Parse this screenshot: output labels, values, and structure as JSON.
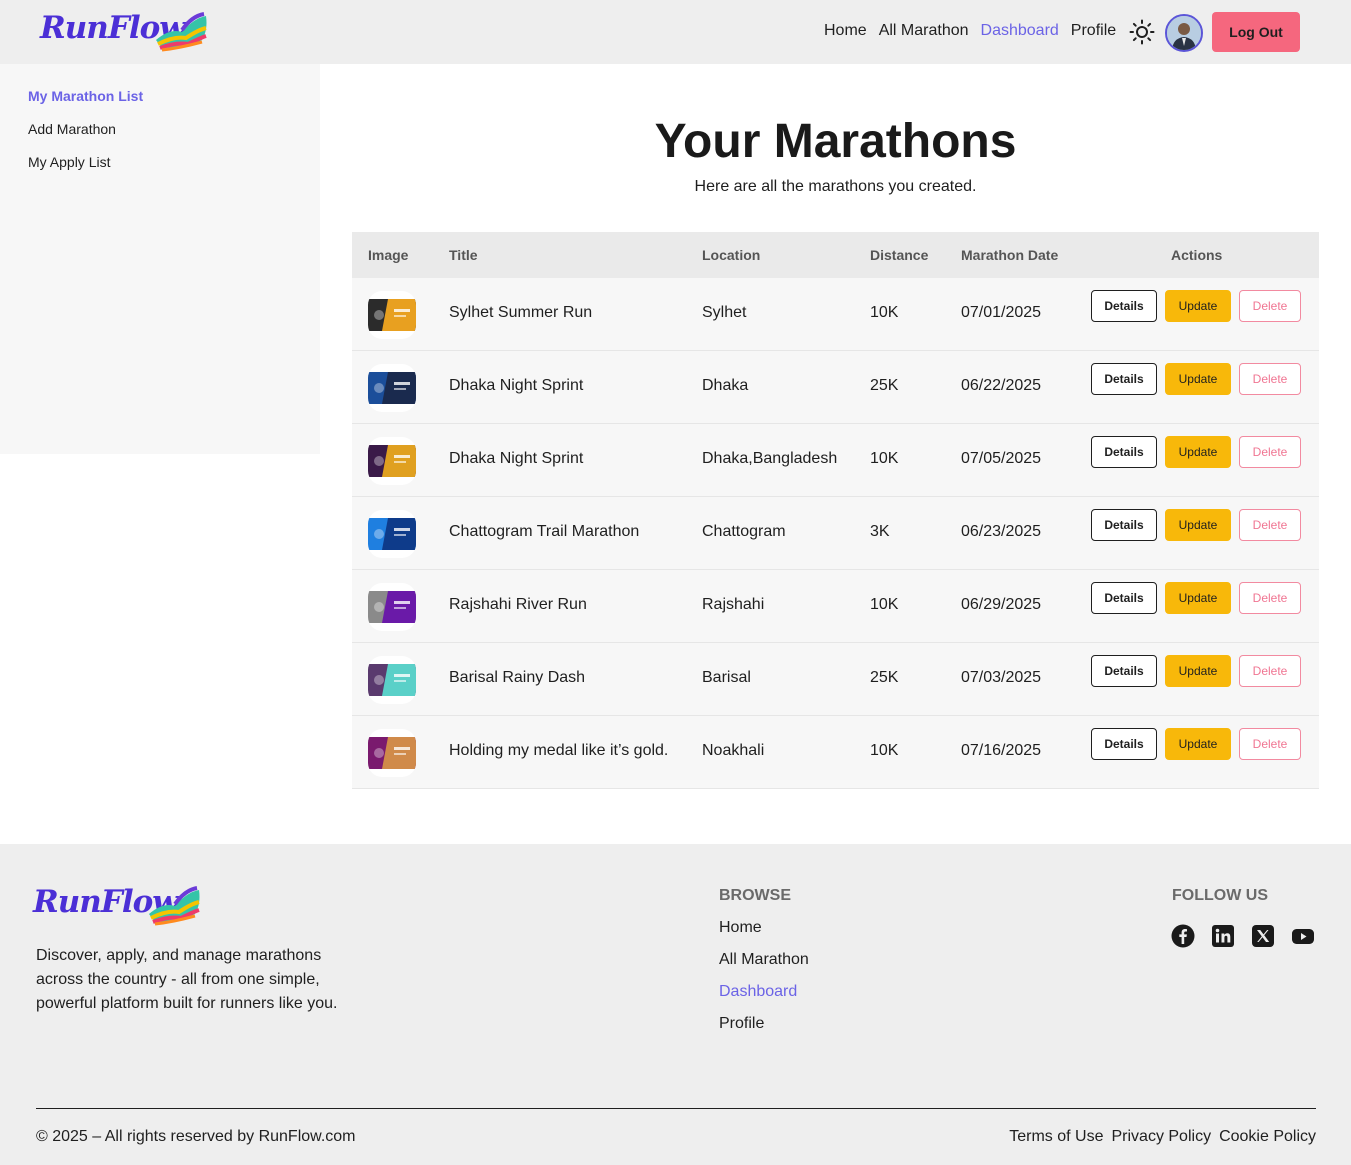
{
  "brand": {
    "name": "RunFlow"
  },
  "nav": {
    "items": [
      {
        "label": "Home",
        "active": false
      },
      {
        "label": "All Marathon",
        "active": false
      },
      {
        "label": "Dashboard",
        "active": true
      },
      {
        "label": "Profile",
        "active": false
      }
    ],
    "theme_icon": "sun-icon",
    "logout_label": "Log Out"
  },
  "sidebar": {
    "items": [
      {
        "label": "My Marathon List",
        "active": true
      },
      {
        "label": "Add Marathon",
        "active": false
      },
      {
        "label": "My Apply List",
        "active": false
      }
    ]
  },
  "main": {
    "title": "Your Marathons",
    "subtitle": "Here are all the marathons you created."
  },
  "table": {
    "columns": [
      "Image",
      "Title",
      "Location",
      "Distance",
      "Marathon Date",
      "Actions"
    ],
    "actions": {
      "details": "Details",
      "update": "Update",
      "delete": "Delete"
    },
    "rows": [
      {
        "title": "Sylhet Summer Run",
        "location": "Sylhet",
        "distance": "10K",
        "date": "07/01/2025",
        "thumb_colors": [
          "#2b2b2b",
          "#e8a020"
        ]
      },
      {
        "title": "Dhaka Night Sprint",
        "location": "Dhaka",
        "distance": "25K",
        "date": "06/22/2025",
        "thumb_colors": [
          "#1b4e9a",
          "#1a2a4e"
        ]
      },
      {
        "title": "Dhaka Night Sprint",
        "location": "Dhaka,Bangladesh",
        "distance": "10K",
        "date": "07/05/2025",
        "thumb_colors": [
          "#3a1a48",
          "#e0a020"
        ]
      },
      {
        "title": "Chattogram Trail Marathon",
        "location": "Chattogram",
        "distance": "3K",
        "date": "06/23/2025",
        "thumb_colors": [
          "#1f7fe0",
          "#0e3b8a"
        ]
      },
      {
        "title": "Rajshahi River Run",
        "location": "Rajshahi",
        "distance": "10K",
        "date": "06/29/2025",
        "thumb_colors": [
          "#8a8a8a",
          "#6a1aa8"
        ]
      },
      {
        "title": "Barisal Rainy Dash",
        "location": "Barisal",
        "distance": "25K",
        "date": "07/03/2025",
        "thumb_colors": [
          "#5a3a6e",
          "#5ad0c8"
        ]
      },
      {
        "title": "Holding my medal like it’s gold.",
        "location": "Noakhali",
        "distance": "10K",
        "date": "07/16/2025",
        "thumb_colors": [
          "#7a1a6e",
          "#d08a4a"
        ]
      }
    ]
  },
  "footer": {
    "description": "Discover, apply, and manage marathons across the country - all from one simple, powerful platform built for runners like you.",
    "browse_title": "BROWSE",
    "browse_links": [
      {
        "label": "Home",
        "active": false
      },
      {
        "label": "All Marathon",
        "active": false
      },
      {
        "label": "Dashboard",
        "active": true
      },
      {
        "label": "Profile",
        "active": false
      }
    ],
    "follow_title": "FOLLOW US",
    "social_icons": [
      "facebook-icon",
      "linkedin-icon",
      "x-icon",
      "youtube-icon"
    ],
    "copyright": "© 2025 – All rights reserved by RunFlow.com",
    "legal_links": [
      "Terms of Use",
      "Privacy Policy",
      "Cookie Policy"
    ]
  }
}
